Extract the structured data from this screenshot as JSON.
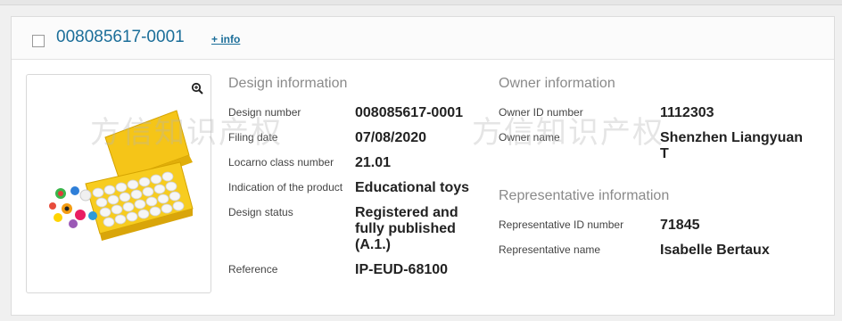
{
  "header": {
    "design_id": "008085617-0001",
    "more_info": "+ info"
  },
  "watermark": "方信知识产权",
  "design_info": {
    "title": "Design information",
    "rows": [
      {
        "label": "Design number",
        "value": "008085617-0001"
      },
      {
        "label": "Filing date",
        "value": "07/08/2020"
      },
      {
        "label": "Locarno class number",
        "value": "21.01"
      },
      {
        "label": "Indication of the product",
        "value": "Educational toys"
      },
      {
        "label": "Design status",
        "value": "Registered and fully published (A.1.)"
      },
      {
        "label": "Reference",
        "value": "IP-EUD-68100"
      }
    ]
  },
  "owner_info": {
    "title": "Owner information",
    "rows": [
      {
        "label": "Owner ID number",
        "value": "1112303"
      },
      {
        "label": "Owner name",
        "value": "Shenzhen Liangyuan T"
      }
    ]
  },
  "representative_info": {
    "title": "Representative information",
    "rows": [
      {
        "label": "Representative ID number",
        "value": "71845"
      },
      {
        "label": "Representative name",
        "value": "Isabelle Bertaux"
      }
    ]
  },
  "colors": {
    "link": "#1b6e99",
    "case_yellow": "#f5c518"
  }
}
